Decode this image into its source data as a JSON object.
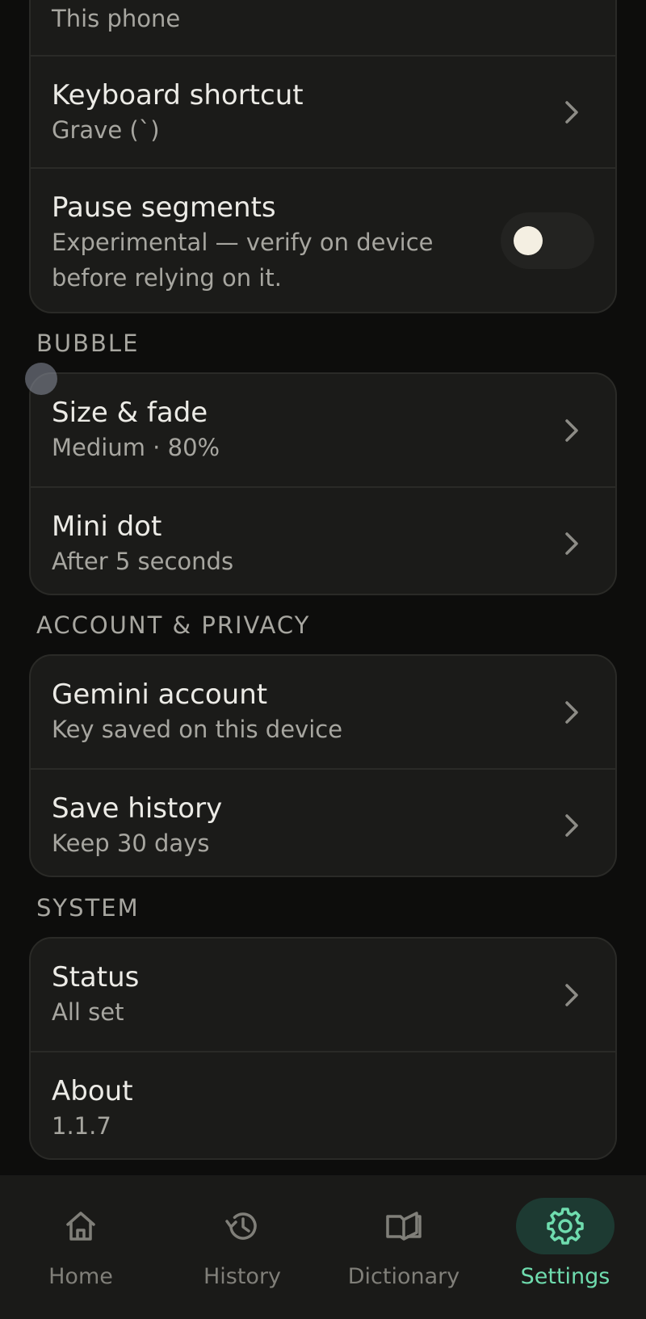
{
  "top_card": {
    "partial_row_sub": "This phone",
    "rows": [
      {
        "title": "Keyboard shortcut",
        "subtitle": "Grave (`)"
      },
      {
        "title": "Pause segments",
        "subtitle_line1": "Experimental — verify on device",
        "subtitle_line2": "before relying on it.",
        "toggle_on": false
      }
    ]
  },
  "sections": {
    "bubble": {
      "label": "BUBBLE",
      "rows": [
        {
          "title": "Size & fade",
          "subtitle": "Medium · 80%"
        },
        {
          "title": "Mini dot",
          "subtitle": "After 5 seconds"
        }
      ]
    },
    "account": {
      "label": "ACCOUNT & PRIVACY",
      "rows": [
        {
          "title": "Gemini account",
          "subtitle": "Key saved on this device"
        },
        {
          "title": "Save history",
          "subtitle": "Keep 30 days"
        }
      ]
    },
    "system": {
      "label": "SYSTEM",
      "rows": [
        {
          "title": "Status",
          "subtitle": "All set"
        },
        {
          "title": "About",
          "subtitle": "1.1.7"
        }
      ]
    }
  },
  "nav": {
    "items": [
      {
        "label": "Home",
        "icon": "home-icon"
      },
      {
        "label": "History",
        "icon": "history-icon"
      },
      {
        "label": "Dictionary",
        "icon": "book-icon"
      },
      {
        "label": "Settings",
        "icon": "gear-icon",
        "active": true
      }
    ]
  },
  "colors": {
    "background": "#0d0d0c",
    "card": "#1b1b19",
    "accent": "#6fdcae",
    "accent_bg": "#1d3a32"
  }
}
